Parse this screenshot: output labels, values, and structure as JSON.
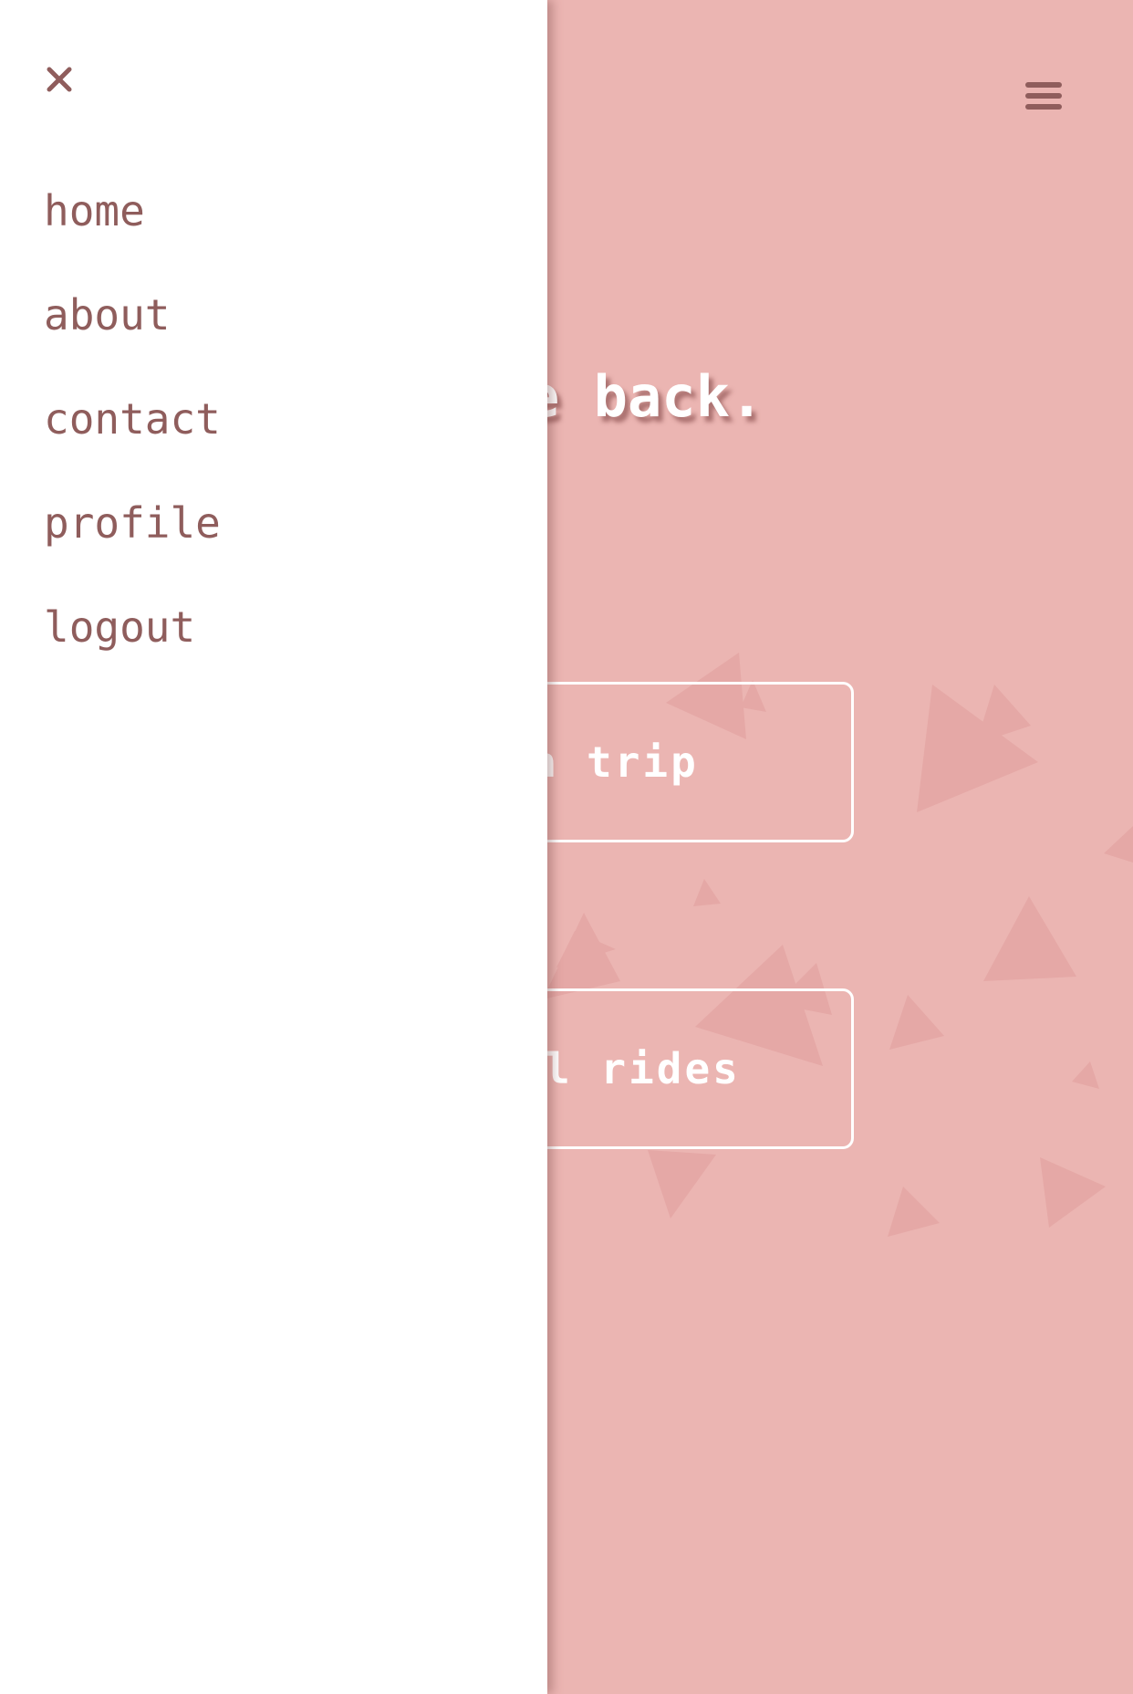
{
  "header": {
    "menu_icon": "hamburger-menu-icon"
  },
  "main": {
    "headline": "Welcome back.",
    "buttons": {
      "plan_trip": "plan a trip",
      "all_rides": "view all rides"
    }
  },
  "drawer": {
    "close_icon": "close-icon",
    "nav": {
      "items": [
        {
          "label": "home"
        },
        {
          "label": "about"
        },
        {
          "label": "contact"
        },
        {
          "label": "profile"
        },
        {
          "label": "logout"
        }
      ]
    }
  },
  "colors": {
    "background": "#ebb5b2",
    "drawer_background": "#ffffff",
    "drawer_text": "#8f5d5c",
    "button_border": "#ffffff",
    "decor_triangles": "#e3a4a2"
  }
}
